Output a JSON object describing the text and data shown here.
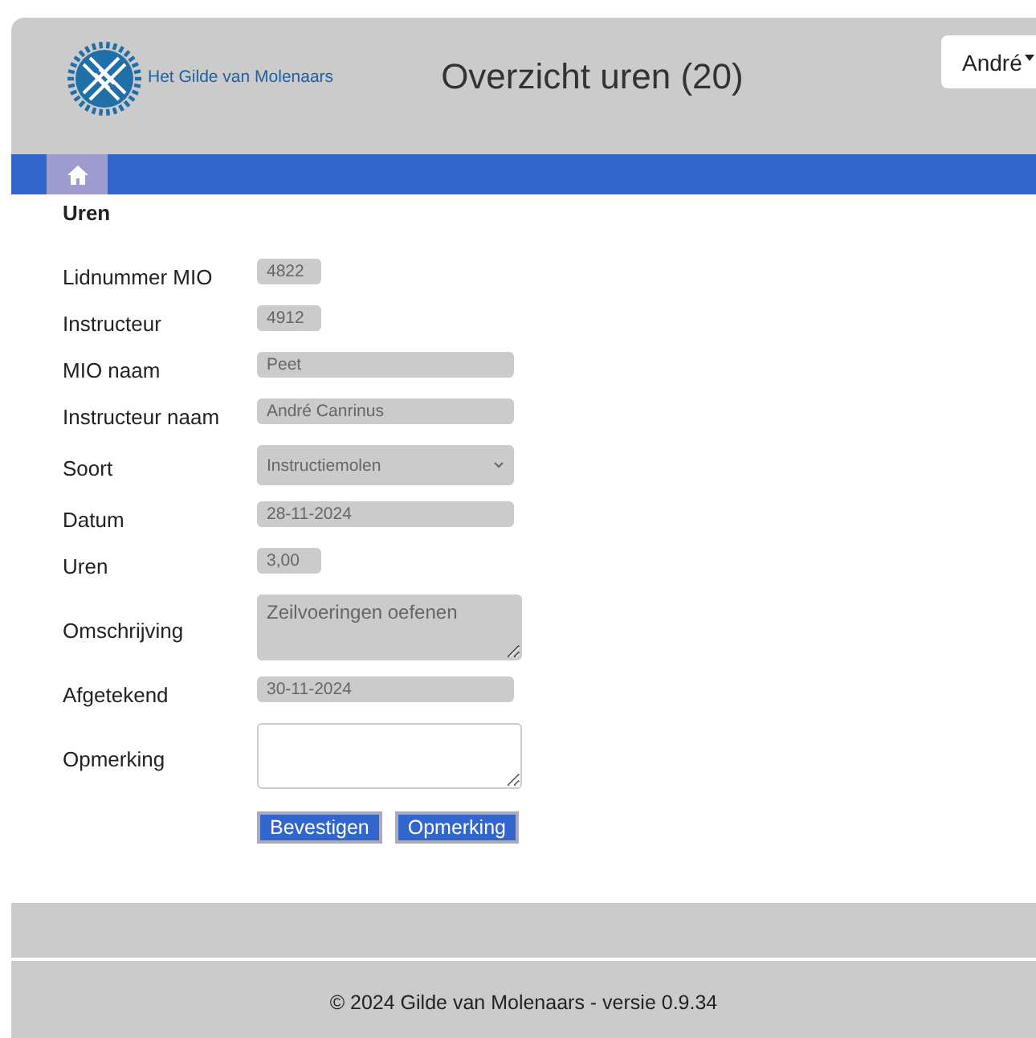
{
  "header": {
    "logo_text": "Het Gilde van Molenaars",
    "title": "Overzicht uren (20)",
    "user_menu": "André"
  },
  "nav": {
    "items": [
      {
        "kind": "home",
        "selected": true
      }
    ]
  },
  "section_title": "Uren",
  "fields": [
    {
      "label": "Lidnummer MIO",
      "kind": "short",
      "value": "4822",
      "disabled": true
    },
    {
      "label": "Instructeur",
      "kind": "short",
      "value": "4912",
      "disabled": true
    },
    {
      "label": "MIO naam",
      "kind": "text",
      "value": "Peet",
      "disabled": true
    },
    {
      "label": "Instructeur naam",
      "kind": "text",
      "value": "André Canrinus",
      "disabled": true
    },
    {
      "label": "Soort",
      "kind": "select",
      "value": "Instructiemolen",
      "disabled": true
    },
    {
      "label": "Datum",
      "kind": "text",
      "value": "28-11-2024",
      "disabled": true
    },
    {
      "label": "Uren",
      "kind": "short",
      "value": "3,00",
      "disabled": true
    },
    {
      "label": "Omschrijving",
      "kind": "textarea",
      "value": "Zeilvoeringen oefenen",
      "disabled": true
    },
    {
      "label": "Afgetekend",
      "kind": "text",
      "value": "30-11-2024",
      "disabled": true
    },
    {
      "label": "Opmerking",
      "kind": "textarea",
      "disabled": false
    }
  ],
  "buttons": [
    "Bevestigen",
    "Opmerking"
  ],
  "footer": "© 2024 Gilde van Molenaars - versie 0.9.34"
}
